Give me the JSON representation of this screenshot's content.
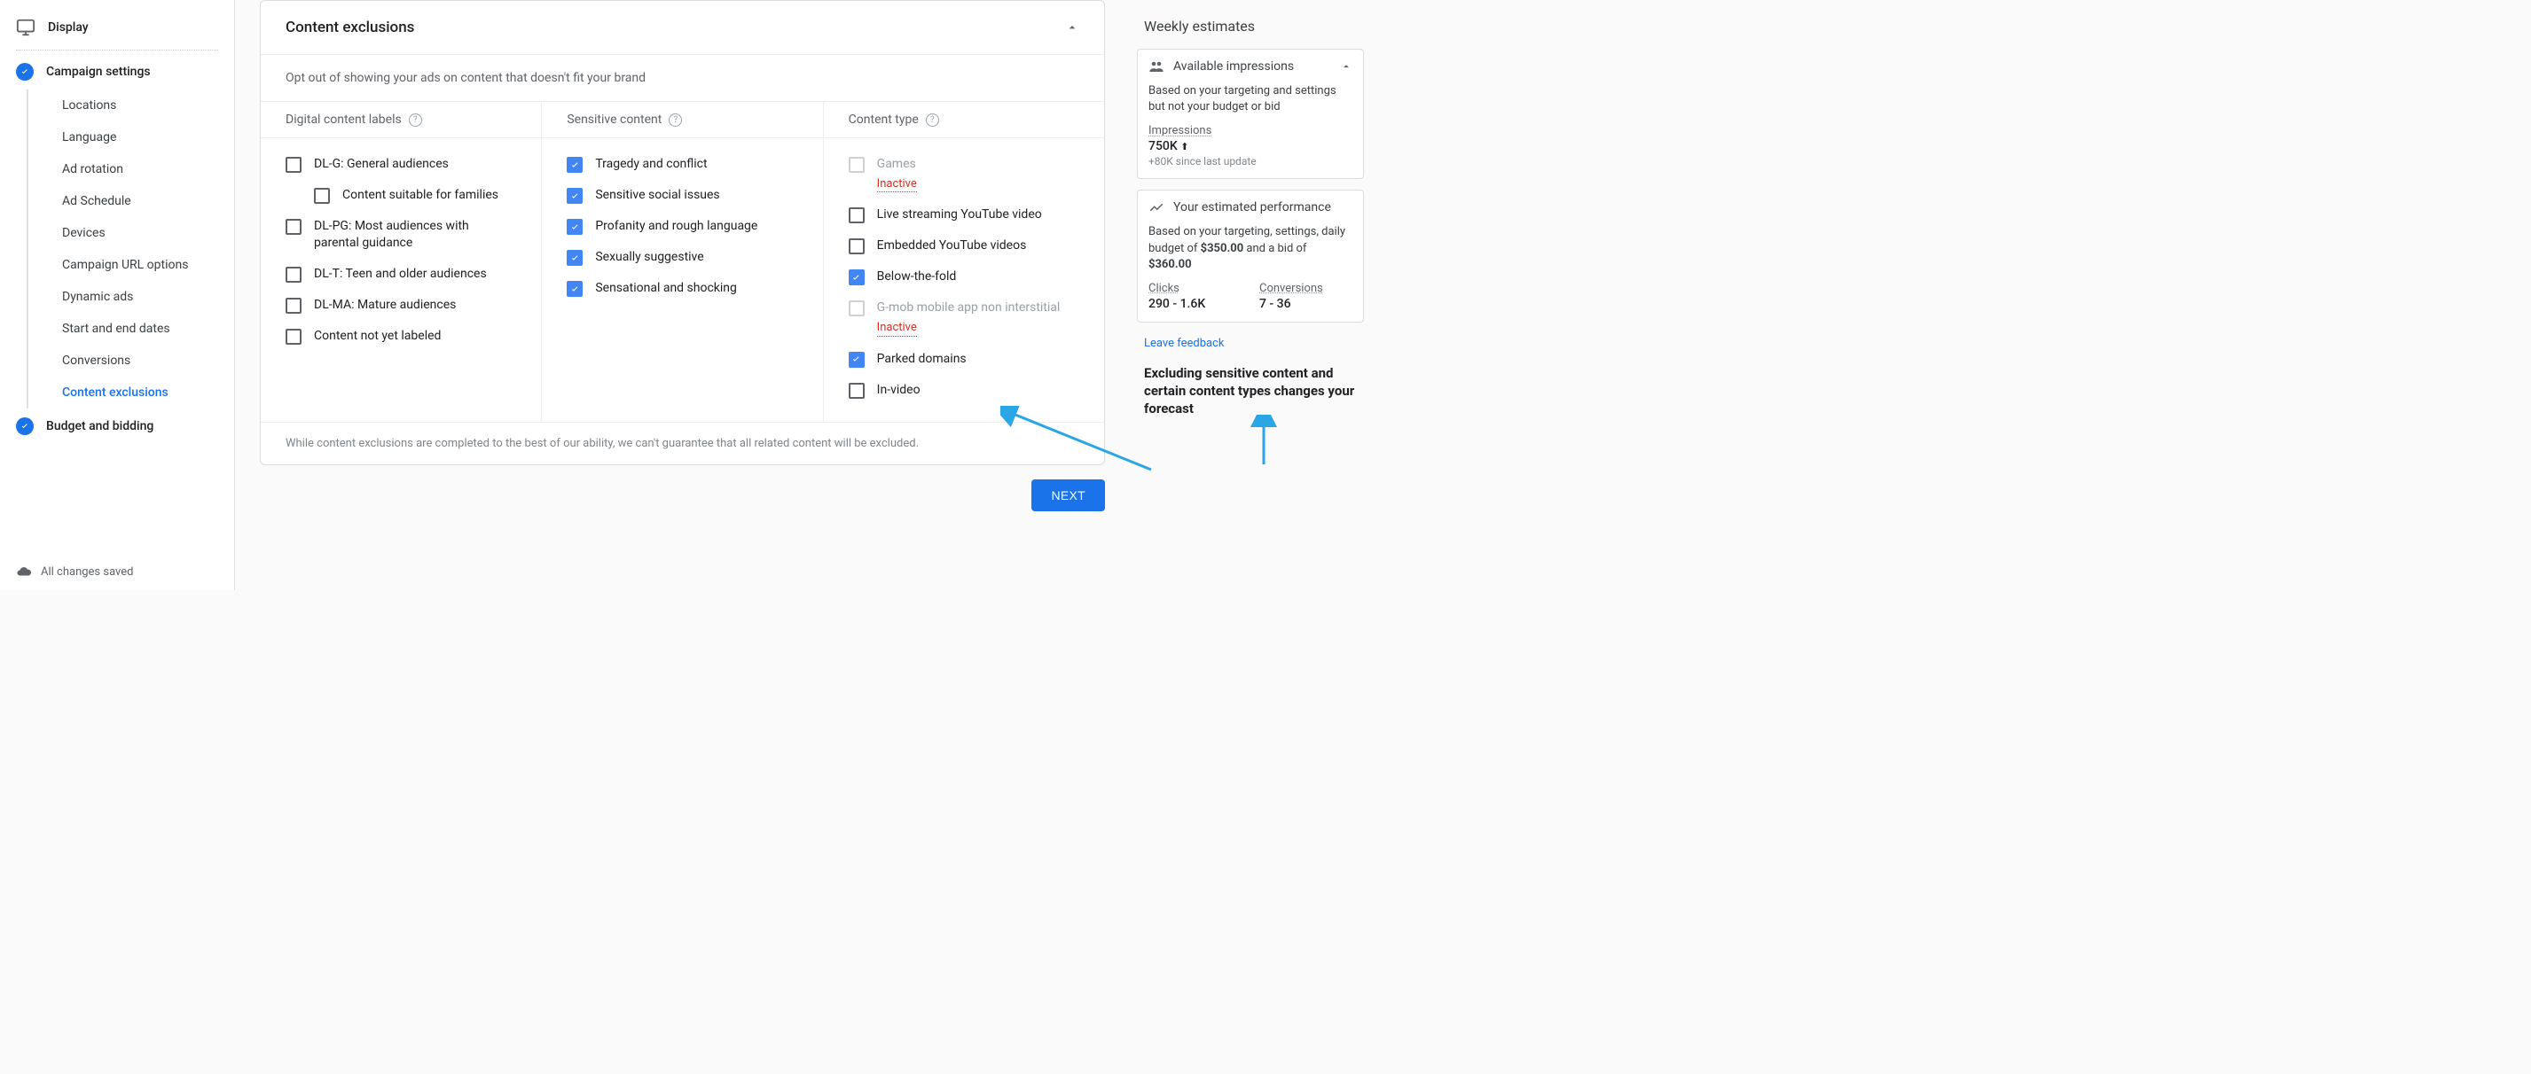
{
  "sidebar": {
    "display": "Display",
    "campaign_settings": "Campaign settings",
    "items": [
      "Locations",
      "Language",
      "Ad rotation",
      "Ad Schedule",
      "Devices",
      "Campaign URL options",
      "Dynamic ads",
      "Start and end dates",
      "Conversions",
      "Content exclusions"
    ],
    "budget_bidding": "Budget and bidding",
    "status": "All changes saved"
  },
  "main": {
    "title": "Content exclusions",
    "subtitle": "Opt out of showing your ads on content that doesn't fit your brand",
    "col1_header": "Digital content labels",
    "col2_header": "Sensitive content",
    "col3_header": "Content type",
    "col1": [
      {
        "label": "DL-G: General audiences"
      },
      {
        "label": "Content suitable for families",
        "indent": true
      },
      {
        "label": "DL-PG: Most audiences with parental guidance"
      },
      {
        "label": "DL-T: Teen and older audiences"
      },
      {
        "label": "DL-MA: Mature audiences"
      },
      {
        "label": "Content not yet labeled"
      }
    ],
    "col2": [
      {
        "label": "Tragedy and conflict",
        "checked": true
      },
      {
        "label": "Sensitive social issues",
        "checked": true
      },
      {
        "label": "Profanity and rough language",
        "checked": true
      },
      {
        "label": "Sexually suggestive",
        "checked": true
      },
      {
        "label": "Sensational and shocking",
        "checked": true
      }
    ],
    "col3": [
      {
        "label": "Games",
        "inactive": true,
        "disabled": true
      },
      {
        "label": "Live streaming YouTube video"
      },
      {
        "label": "Embedded YouTube videos"
      },
      {
        "label": "Below-the-fold",
        "checked": true
      },
      {
        "label": "G-mob mobile app non interstitial",
        "inactive": true,
        "disabled": true
      },
      {
        "label": "Parked domains",
        "checked": true
      },
      {
        "label": "In-video"
      }
    ],
    "inactive_text": "Inactive",
    "footnote": "While content exclusions are completed to the best of our ability, we can't guarantee that all related content will be excluded.",
    "next": "NEXT"
  },
  "right": {
    "title": "Weekly estimates",
    "impressions": {
      "title": "Available impressions",
      "desc": "Based on your targeting and settings but not your budget or bid",
      "metric_label": "Impressions",
      "metric_value": "750K",
      "metric_sub": "+80K since last update"
    },
    "performance": {
      "title": "Your estimated performance",
      "desc_prefix": "Based on your targeting, settings, daily budget of ",
      "budget": "$350.00",
      "desc_mid": " and a bid of ",
      "bid": "$360.00",
      "clicks_label": "Clicks",
      "clicks_value": "290 - 1.6K",
      "conv_label": "Conversions",
      "conv_value": "7 - 36"
    },
    "leave_feedback": "Leave feedback",
    "annotation": "Excluding sensitive content and certain content types changes your forecast"
  }
}
